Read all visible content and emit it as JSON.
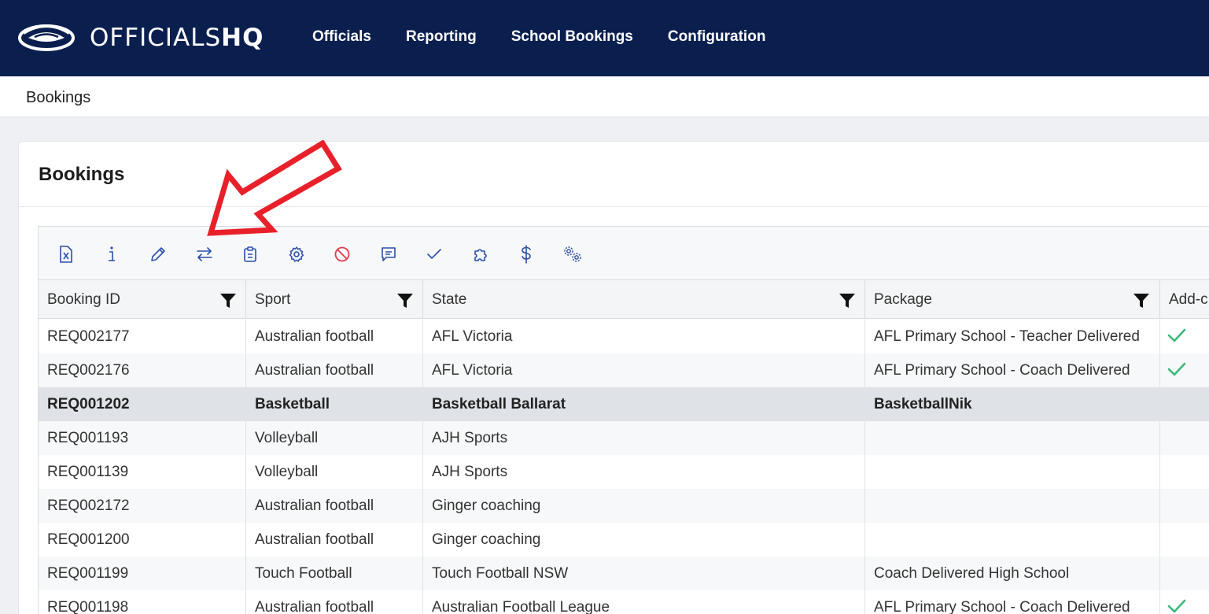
{
  "brand": {
    "name_light": "OFFICIALS",
    "name_bold": "HQ"
  },
  "nav": {
    "items": [
      "Officials",
      "Reporting",
      "School Bookings",
      "Configuration"
    ]
  },
  "breadcrumb": "Bookings",
  "card": {
    "title": "Bookings"
  },
  "toolbar": {
    "icons": [
      "excel-export-icon",
      "info-icon",
      "pencil-icon",
      "swap-arrows-icon",
      "clipboard-icon",
      "gear-icon",
      "cancel-icon",
      "comment-icon",
      "check-icon",
      "puzzle-icon",
      "dollar-icon",
      "gears-icon"
    ]
  },
  "table": {
    "columns": [
      "Booking ID",
      "Sport",
      "State",
      "Package",
      "Add-c"
    ],
    "rows": [
      {
        "id": "REQ002177",
        "sport": "Australian football",
        "state": "AFL Victoria",
        "package": "AFL Primary School - Teacher Delivered",
        "addon": true
      },
      {
        "id": "REQ002176",
        "sport": "Australian football",
        "state": "AFL Victoria",
        "package": "AFL Primary School - Coach Delivered",
        "addon": true
      },
      {
        "id": "REQ001202",
        "sport": "Basketball",
        "state": "Basketball Ballarat",
        "package": "BasketballNik",
        "addon": false
      },
      {
        "id": "REQ001193",
        "sport": "Volleyball",
        "state": "AJH Sports",
        "package": "",
        "addon": false
      },
      {
        "id": "REQ001139",
        "sport": "Volleyball",
        "state": "AJH Sports",
        "package": "",
        "addon": false
      },
      {
        "id": "REQ002172",
        "sport": "Australian football",
        "state": "Ginger coaching",
        "package": "",
        "addon": false
      },
      {
        "id": "REQ001200",
        "sport": "Australian football",
        "state": "Ginger coaching",
        "package": "",
        "addon": false
      },
      {
        "id": "REQ001199",
        "sport": "Touch Football",
        "state": "Touch Football NSW",
        "package": "Coach Delivered High School",
        "addon": false
      },
      {
        "id": "REQ001198",
        "sport": "Australian football",
        "state": "Australian Football League",
        "package": "AFL Primary School - Coach Delivered",
        "addon": true
      }
    ]
  },
  "colors": {
    "nav_bg": "#0b1f4f",
    "icon_blue": "#2b4fa8",
    "cancel_red": "#e03a4a",
    "check_green": "#3cb878",
    "annotation_red": "#e8202a"
  }
}
